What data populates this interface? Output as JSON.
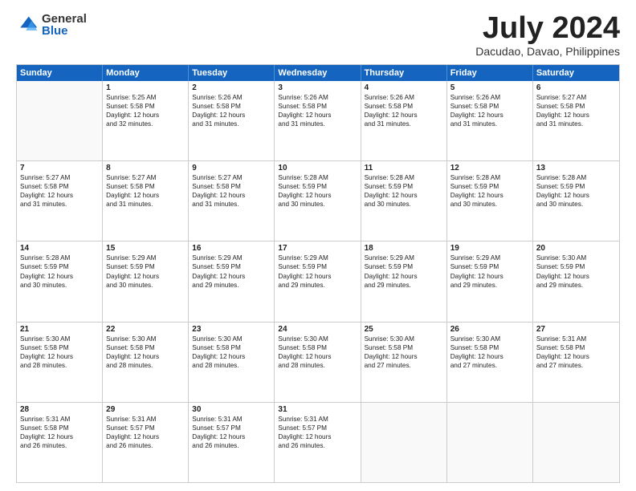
{
  "logo": {
    "general": "General",
    "blue": "Blue"
  },
  "title": "July 2024",
  "location": "Dacudao, Davao, Philippines",
  "header_days": [
    "Sunday",
    "Monday",
    "Tuesday",
    "Wednesday",
    "Thursday",
    "Friday",
    "Saturday"
  ],
  "weeks": [
    [
      {
        "day": "",
        "info": ""
      },
      {
        "day": "1",
        "info": "Sunrise: 5:25 AM\nSunset: 5:58 PM\nDaylight: 12 hours\nand 32 minutes."
      },
      {
        "day": "2",
        "info": "Sunrise: 5:26 AM\nSunset: 5:58 PM\nDaylight: 12 hours\nand 31 minutes."
      },
      {
        "day": "3",
        "info": "Sunrise: 5:26 AM\nSunset: 5:58 PM\nDaylight: 12 hours\nand 31 minutes."
      },
      {
        "day": "4",
        "info": "Sunrise: 5:26 AM\nSunset: 5:58 PM\nDaylight: 12 hours\nand 31 minutes."
      },
      {
        "day": "5",
        "info": "Sunrise: 5:26 AM\nSunset: 5:58 PM\nDaylight: 12 hours\nand 31 minutes."
      },
      {
        "day": "6",
        "info": "Sunrise: 5:27 AM\nSunset: 5:58 PM\nDaylight: 12 hours\nand 31 minutes."
      }
    ],
    [
      {
        "day": "7",
        "info": "Sunrise: 5:27 AM\nSunset: 5:58 PM\nDaylight: 12 hours\nand 31 minutes."
      },
      {
        "day": "8",
        "info": "Sunrise: 5:27 AM\nSunset: 5:58 PM\nDaylight: 12 hours\nand 31 minutes."
      },
      {
        "day": "9",
        "info": "Sunrise: 5:27 AM\nSunset: 5:58 PM\nDaylight: 12 hours\nand 31 minutes."
      },
      {
        "day": "10",
        "info": "Sunrise: 5:28 AM\nSunset: 5:59 PM\nDaylight: 12 hours\nand 30 minutes."
      },
      {
        "day": "11",
        "info": "Sunrise: 5:28 AM\nSunset: 5:59 PM\nDaylight: 12 hours\nand 30 minutes."
      },
      {
        "day": "12",
        "info": "Sunrise: 5:28 AM\nSunset: 5:59 PM\nDaylight: 12 hours\nand 30 minutes."
      },
      {
        "day": "13",
        "info": "Sunrise: 5:28 AM\nSunset: 5:59 PM\nDaylight: 12 hours\nand 30 minutes."
      }
    ],
    [
      {
        "day": "14",
        "info": "Sunrise: 5:28 AM\nSunset: 5:59 PM\nDaylight: 12 hours\nand 30 minutes."
      },
      {
        "day": "15",
        "info": "Sunrise: 5:29 AM\nSunset: 5:59 PM\nDaylight: 12 hours\nand 30 minutes."
      },
      {
        "day": "16",
        "info": "Sunrise: 5:29 AM\nSunset: 5:59 PM\nDaylight: 12 hours\nand 29 minutes."
      },
      {
        "day": "17",
        "info": "Sunrise: 5:29 AM\nSunset: 5:59 PM\nDaylight: 12 hours\nand 29 minutes."
      },
      {
        "day": "18",
        "info": "Sunrise: 5:29 AM\nSunset: 5:59 PM\nDaylight: 12 hours\nand 29 minutes."
      },
      {
        "day": "19",
        "info": "Sunrise: 5:29 AM\nSunset: 5:59 PM\nDaylight: 12 hours\nand 29 minutes."
      },
      {
        "day": "20",
        "info": "Sunrise: 5:30 AM\nSunset: 5:59 PM\nDaylight: 12 hours\nand 29 minutes."
      }
    ],
    [
      {
        "day": "21",
        "info": "Sunrise: 5:30 AM\nSunset: 5:58 PM\nDaylight: 12 hours\nand 28 minutes."
      },
      {
        "day": "22",
        "info": "Sunrise: 5:30 AM\nSunset: 5:58 PM\nDaylight: 12 hours\nand 28 minutes."
      },
      {
        "day": "23",
        "info": "Sunrise: 5:30 AM\nSunset: 5:58 PM\nDaylight: 12 hours\nand 28 minutes."
      },
      {
        "day": "24",
        "info": "Sunrise: 5:30 AM\nSunset: 5:58 PM\nDaylight: 12 hours\nand 28 minutes."
      },
      {
        "day": "25",
        "info": "Sunrise: 5:30 AM\nSunset: 5:58 PM\nDaylight: 12 hours\nand 27 minutes."
      },
      {
        "day": "26",
        "info": "Sunrise: 5:30 AM\nSunset: 5:58 PM\nDaylight: 12 hours\nand 27 minutes."
      },
      {
        "day": "27",
        "info": "Sunrise: 5:31 AM\nSunset: 5:58 PM\nDaylight: 12 hours\nand 27 minutes."
      }
    ],
    [
      {
        "day": "28",
        "info": "Sunrise: 5:31 AM\nSunset: 5:58 PM\nDaylight: 12 hours\nand 26 minutes."
      },
      {
        "day": "29",
        "info": "Sunrise: 5:31 AM\nSunset: 5:57 PM\nDaylight: 12 hours\nand 26 minutes."
      },
      {
        "day": "30",
        "info": "Sunrise: 5:31 AM\nSunset: 5:57 PM\nDaylight: 12 hours\nand 26 minutes."
      },
      {
        "day": "31",
        "info": "Sunrise: 5:31 AM\nSunset: 5:57 PM\nDaylight: 12 hours\nand 26 minutes."
      },
      {
        "day": "",
        "info": ""
      },
      {
        "day": "",
        "info": ""
      },
      {
        "day": "",
        "info": ""
      }
    ]
  ]
}
